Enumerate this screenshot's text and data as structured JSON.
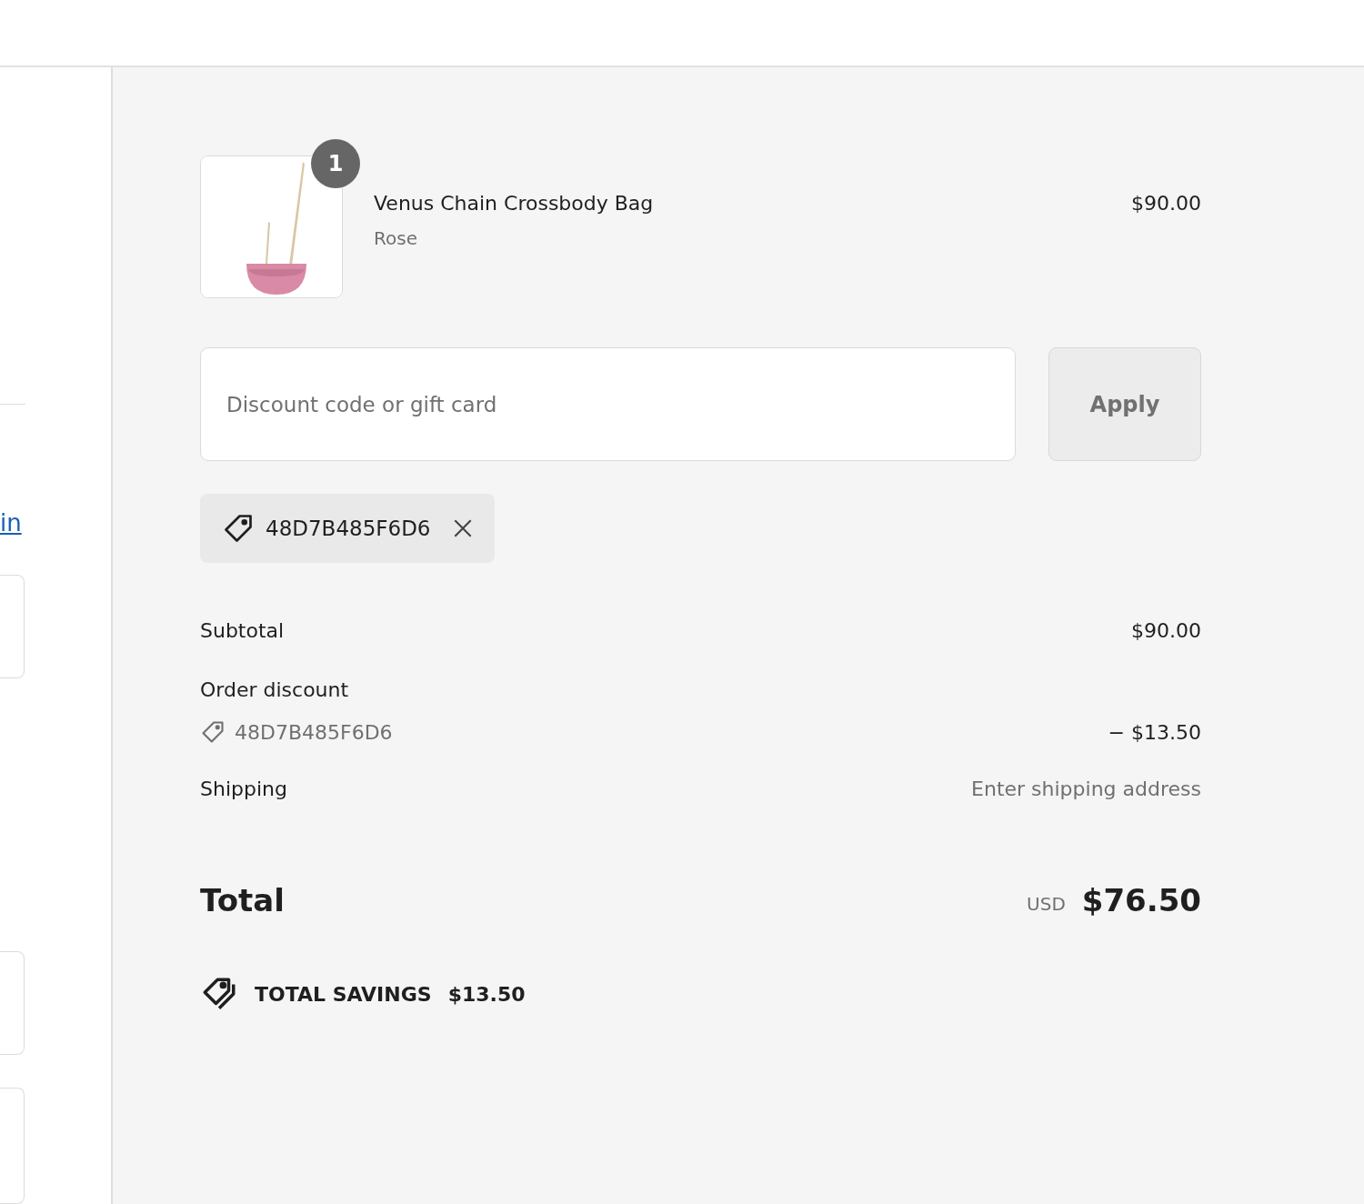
{
  "left_column": {
    "link": "in"
  },
  "item": {
    "quantity": "1",
    "name": "Venus Chain Crossbody Bag",
    "variant": "Rose",
    "price": "$90.00"
  },
  "discount": {
    "placeholder": "Discount code or gift card",
    "button": "Apply",
    "applied_codes": [
      {
        "code": "48D7B485F6D6"
      }
    ]
  },
  "summary": [
    {
      "kind": "line",
      "label": "Subtotal",
      "value": "$90.00"
    },
    {
      "kind": "discount",
      "label": "Order discount",
      "code": "48D7B485F6D6",
      "value": "− $13.50"
    },
    {
      "kind": "muted",
      "label": "Shipping",
      "value": "Enter shipping address"
    }
  ],
  "total": {
    "label": "Total",
    "currency": "USD",
    "amount": "$76.50"
  },
  "savings": {
    "label": "TOTAL SAVINGS",
    "amount": "$13.50"
  }
}
